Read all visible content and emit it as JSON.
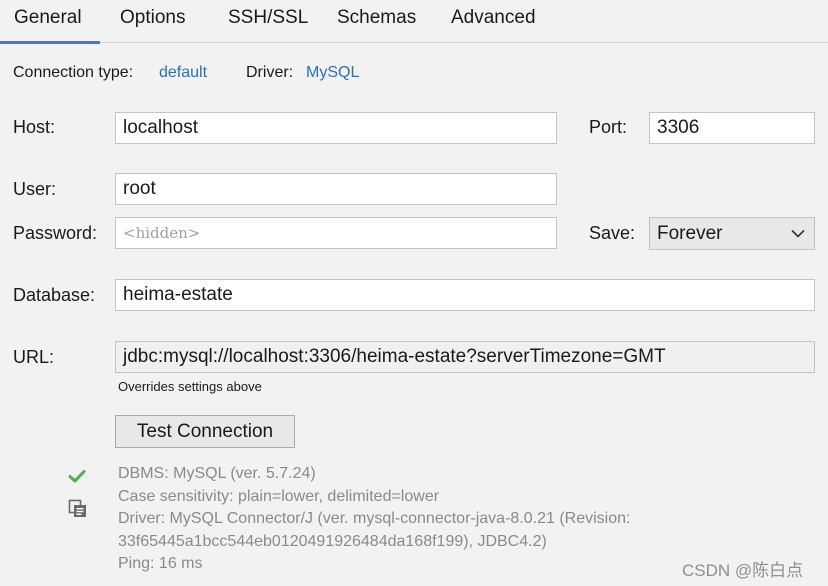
{
  "tabs": [
    {
      "label": "General",
      "active": true
    },
    {
      "label": "Options",
      "active": false
    },
    {
      "label": "SSH/SSL",
      "active": false
    },
    {
      "label": "Schemas",
      "active": false
    },
    {
      "label": "Advanced",
      "active": false
    }
  ],
  "connection": {
    "type_label": "Connection type:",
    "type_value": "default",
    "driver_label": "Driver:",
    "driver_value": "MySQL"
  },
  "form": {
    "host_label": "Host:",
    "host_value": "localhost",
    "port_label": "Port:",
    "port_value": "3306",
    "user_label": "User:",
    "user_value": "root",
    "password_label": "Password:",
    "password_placeholder": "<hidden>",
    "save_label": "Save:",
    "save_value": "Forever",
    "database_label": "Database:",
    "database_value": "heima-estate",
    "url_label": "URL:",
    "url_value": "jdbc:mysql://localhost:3306/heima-estate?serverTimezone=GMT",
    "url_note": "Overrides settings above"
  },
  "test_button_label": "Test Connection",
  "result": {
    "status_icon": "checkmark-icon",
    "copy_icon": "copy-icon",
    "status_color": "#4caf50",
    "lines": [
      "DBMS: MySQL (ver. 5.7.24)",
      "Case sensitivity: plain=lower, delimited=lower",
      "Driver: MySQL Connector/J (ver. mysql-connector-java-8.0.21 (Revision:",
      "33f65445a1bcc544eb0120491926484da168f199), JDBC4.2)",
      "Ping: 16 ms"
    ]
  },
  "colors": {
    "accent": "#3a7dc9",
    "link": "#2a6fbf",
    "muted_text": "#8a8a8a"
  },
  "watermark": "CSDN @陈白点"
}
